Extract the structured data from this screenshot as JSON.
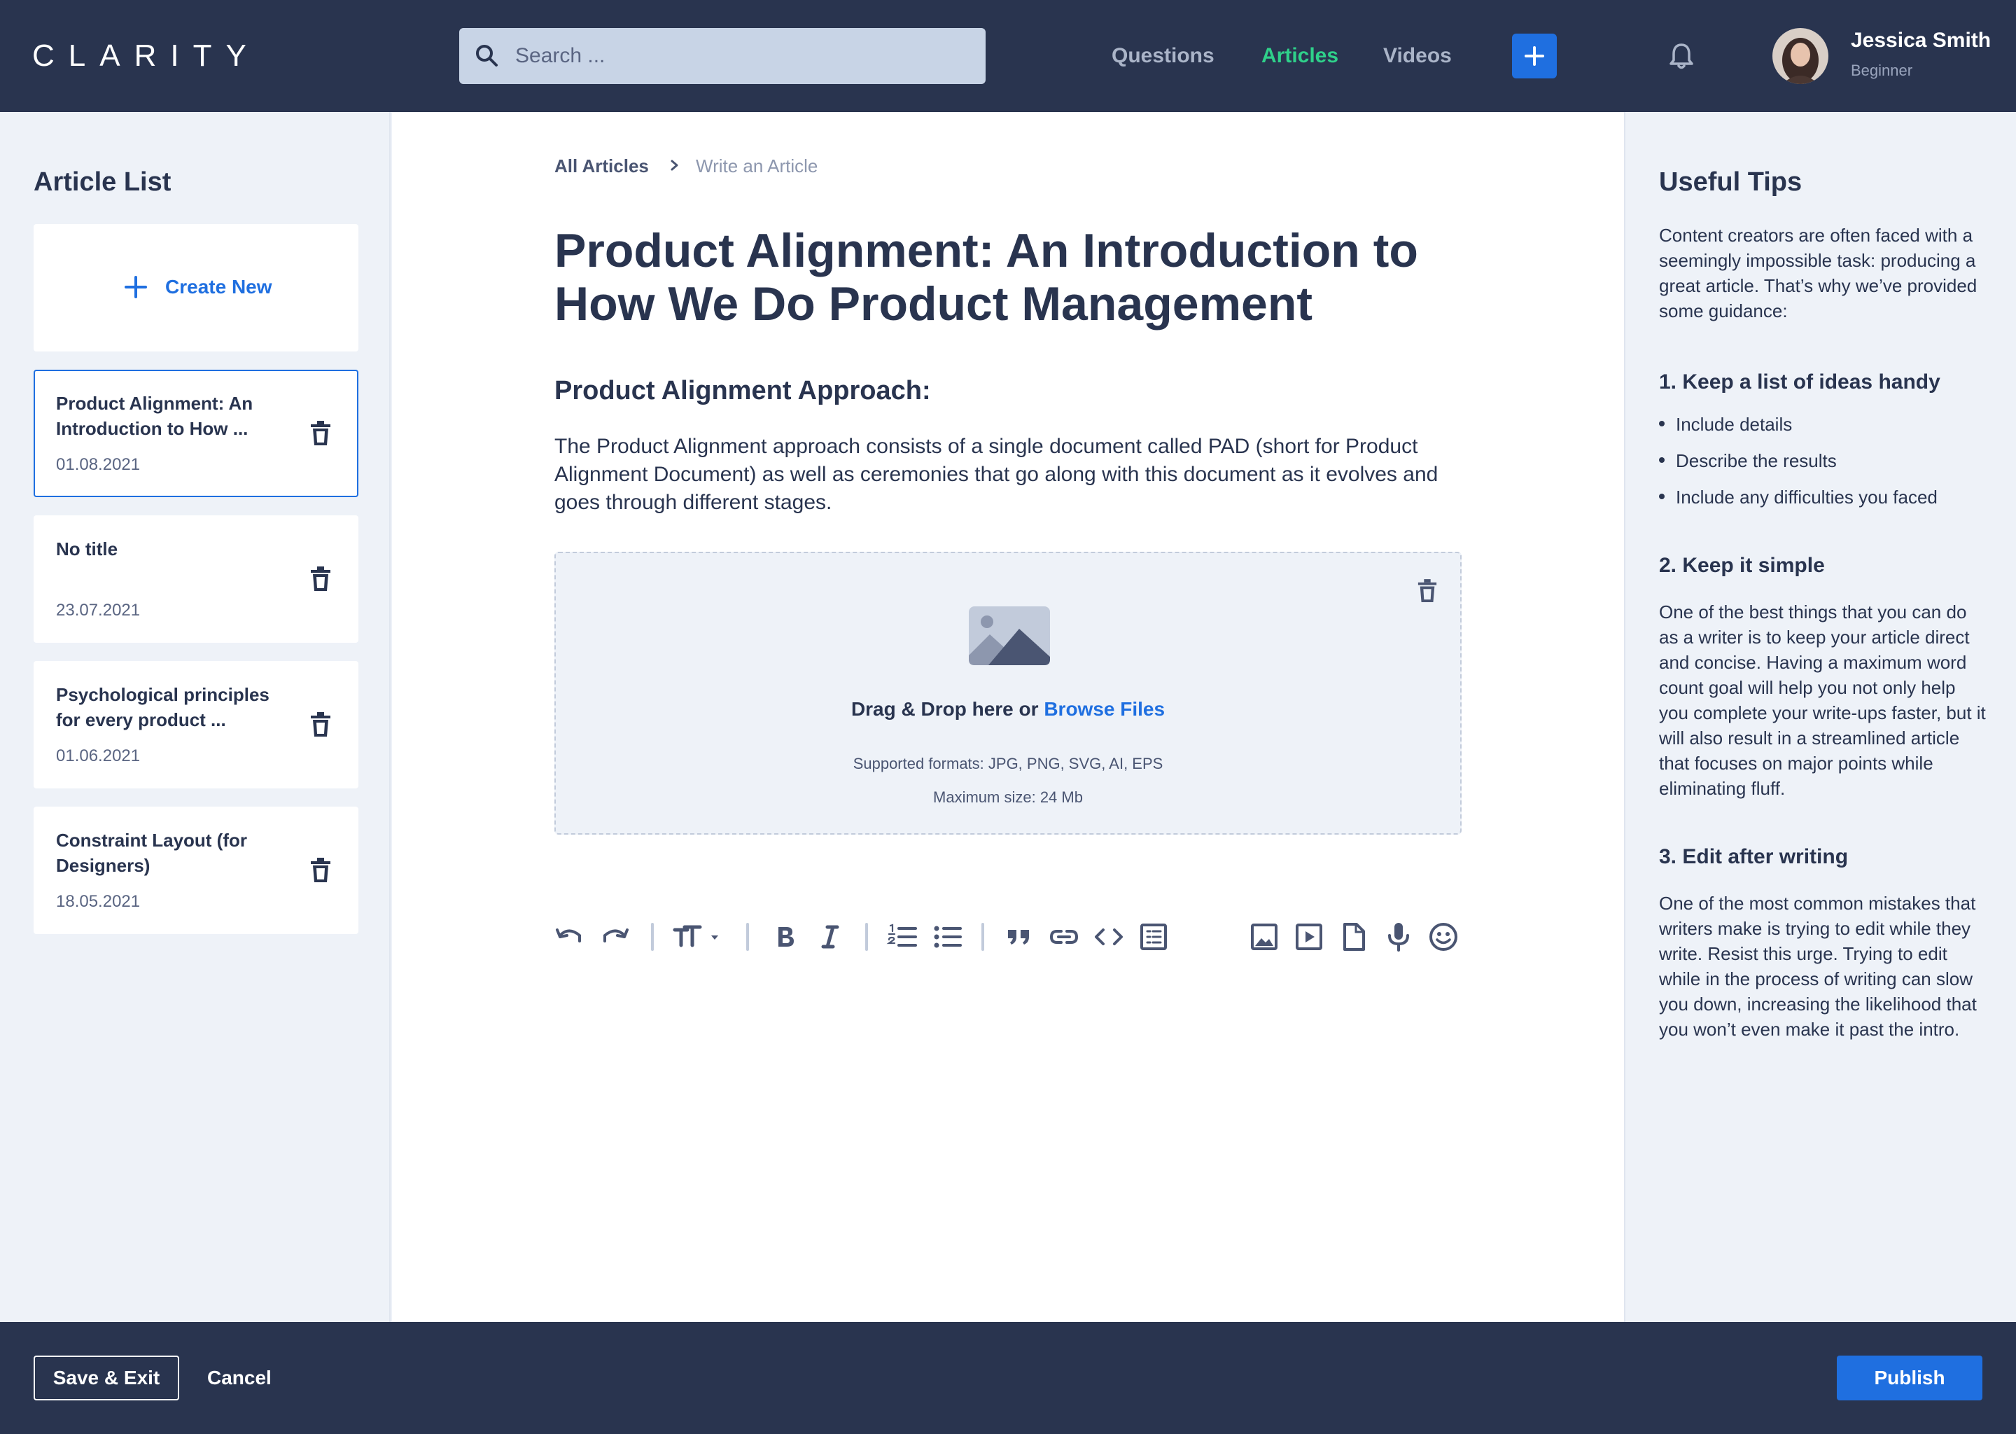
{
  "header": {
    "logo": "CLARITY",
    "search_placeholder": "Search ...",
    "nav": [
      {
        "label": "Questions",
        "active": false
      },
      {
        "label": "Articles",
        "active": true
      },
      {
        "label": "Videos",
        "active": false
      }
    ],
    "user": {
      "name": "Jessica Smith",
      "role": "Beginner"
    }
  },
  "left_panel": {
    "title": "Article List",
    "create_label": "Create New",
    "articles": [
      {
        "title": "Product Alignment: An Introduction to How ...",
        "date": "01.08.2021",
        "active": true
      },
      {
        "title": "No title",
        "date": "23.07.2021",
        "active": false
      },
      {
        "title": "Psychological principles for every product ...",
        "date": "01.06.2021",
        "active": false
      },
      {
        "title": "Constraint Layout (for Designers)",
        "date": "18.05.2021",
        "active": false
      }
    ]
  },
  "main": {
    "breadcrumb": [
      "All Articles",
      "Write an Article"
    ],
    "title": "Product Alignment: An Introduction to How We Do Product Management",
    "section_title": "Product Alignment Approach:",
    "paragraph": "The Product Alignment approach consists of a single document called PAD (short for Product Alignment Document) as well as ceremonies that go along with this document as it evolves and goes through different stages.",
    "dropzone": {
      "prompt": "Drag & Drop here or",
      "browse": "Browse Files",
      "formats": "Supported formats: JPG, PNG, SVG, AI, EPS",
      "max_size": "Maximum size: 24 Mb"
    },
    "toolbar": [
      "undo-icon",
      "redo-icon",
      "text-size-icon",
      "bold-icon",
      "italic-icon",
      "numbered-list-icon",
      "bullet-list-icon",
      "quote-icon",
      "link-icon",
      "code-icon",
      "table-icon",
      "image-icon",
      "video-icon",
      "file-icon",
      "microphone-icon",
      "emoji-icon"
    ]
  },
  "right_panel": {
    "title": "Useful Tips",
    "intro": "Content creators are often faced with a seemingly impossible task: producing a great article. That’s why we’ve provided some guidance:",
    "tips": [
      {
        "heading": "1. Keep a list of ideas handy",
        "items": [
          "Include details",
          "Describe the results",
          "Include any difficulties you faced"
        ]
      },
      {
        "heading": "2. Keep it simple",
        "text": "One of the best things that you can do as a writer is to keep your article direct and concise. Having a maximum word count goal will help you not only help you complete your write-ups faster, but it will also result in a streamlined article that focuses on major points while eliminating fluff."
      },
      {
        "heading": "3. Edit after writing",
        "text": "One of the most common mistakes that writers make is trying to edit while they write. Resist this urge. Trying to edit while in the process of writing can slow you down, increasing the likelihood that you won’t even make it past the intro."
      }
    ]
  },
  "footer": {
    "save_exit": "Save & Exit",
    "cancel": "Cancel",
    "publish": "Publish"
  },
  "colors": {
    "navy": "#29344f",
    "accent_blue": "#1f6fe0",
    "active_green": "#2fd08a",
    "panel_bg": "#eef2f8"
  }
}
